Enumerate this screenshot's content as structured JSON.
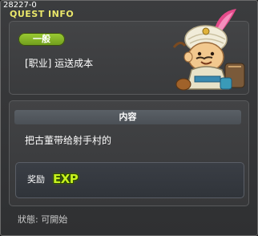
{
  "window": {
    "quest_id": "28227-0",
    "title": "QUEST INFO"
  },
  "quest": {
    "category": "一般",
    "name": "[职业] 运送成本"
  },
  "content": {
    "header": "内容",
    "description": "把古董带给射手村的"
  },
  "reward": {
    "label": "奖励",
    "exp_icon_text": "EXP"
  },
  "status": {
    "text": "狀態: 可開始"
  },
  "icons": {
    "npc": "genie-npc-portrait",
    "exp": "exp-icon"
  },
  "colors": {
    "title": "#e9e66a",
    "category_pill": "#8bbd2a",
    "exp": "#c7f21f"
  }
}
